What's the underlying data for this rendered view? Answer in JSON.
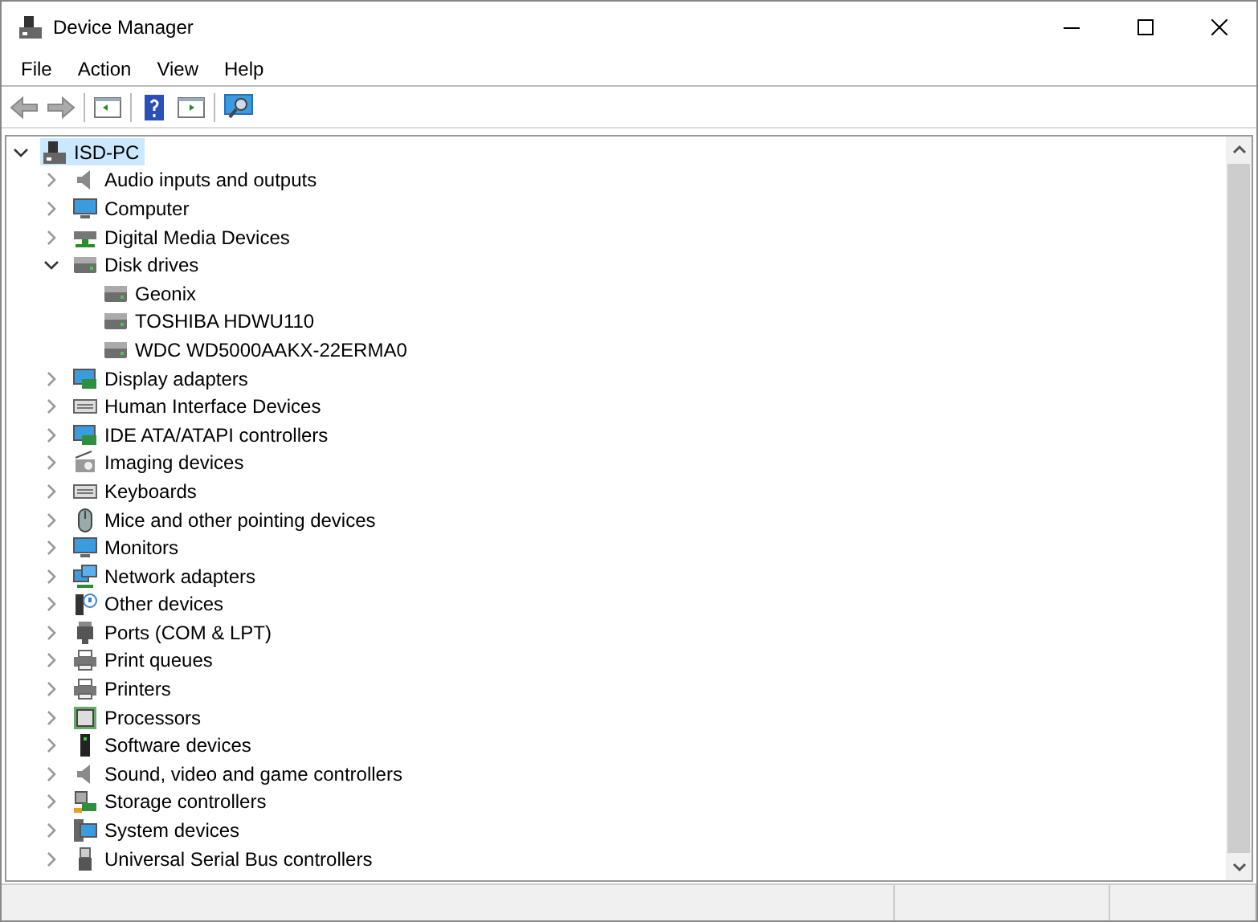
{
  "window": {
    "title": "Device Manager"
  },
  "menu": [
    "File",
    "Action",
    "View",
    "Help"
  ],
  "tree": {
    "label": "ISD-PC",
    "kind": "pc",
    "expanded": true,
    "selected": true,
    "children": [
      {
        "label": "Audio inputs and outputs",
        "kind": "speaker",
        "expanded": false
      },
      {
        "label": "Computer",
        "kind": "monitor",
        "expanded": false
      },
      {
        "label": "Digital Media Devices",
        "kind": "media",
        "expanded": false
      },
      {
        "label": "Disk drives",
        "kind": "drive",
        "expanded": true,
        "children": [
          {
            "label": "Geonix",
            "kind": "drive"
          },
          {
            "label": "TOSHIBA HDWU110",
            "kind": "drive"
          },
          {
            "label": "WDC WD5000AAKX-22ERMA0",
            "kind": "drive"
          }
        ]
      },
      {
        "label": "Display adapters",
        "kind": "card",
        "expanded": false
      },
      {
        "label": "Human Interface Devices",
        "kind": "keyboard",
        "expanded": false
      },
      {
        "label": "IDE ATA/ATAPI controllers",
        "kind": "card",
        "expanded": false
      },
      {
        "label": "Imaging devices",
        "kind": "camera",
        "expanded": false
      },
      {
        "label": "Keyboards",
        "kind": "keyboard",
        "expanded": false
      },
      {
        "label": "Mice and other pointing devices",
        "kind": "mouse",
        "expanded": false
      },
      {
        "label": "Monitors",
        "kind": "monitor",
        "expanded": false
      },
      {
        "label": "Network adapters",
        "kind": "network",
        "expanded": false
      },
      {
        "label": "Other devices",
        "kind": "unknown",
        "expanded": false
      },
      {
        "label": "Ports (COM & LPT)",
        "kind": "port",
        "expanded": false
      },
      {
        "label": "Print queues",
        "kind": "printer",
        "expanded": false
      },
      {
        "label": "Printers",
        "kind": "printer",
        "expanded": false
      },
      {
        "label": "Processors",
        "kind": "chip",
        "expanded": false
      },
      {
        "label": "Software devices",
        "kind": "tower",
        "expanded": false
      },
      {
        "label": "Sound, video and game controllers",
        "kind": "speaker",
        "expanded": false
      },
      {
        "label": "Storage controllers",
        "kind": "storage",
        "expanded": false
      },
      {
        "label": "System devices",
        "kind": "system",
        "expanded": false
      },
      {
        "label": "Universal Serial Bus controllers",
        "kind": "usb",
        "expanded": false
      }
    ]
  }
}
